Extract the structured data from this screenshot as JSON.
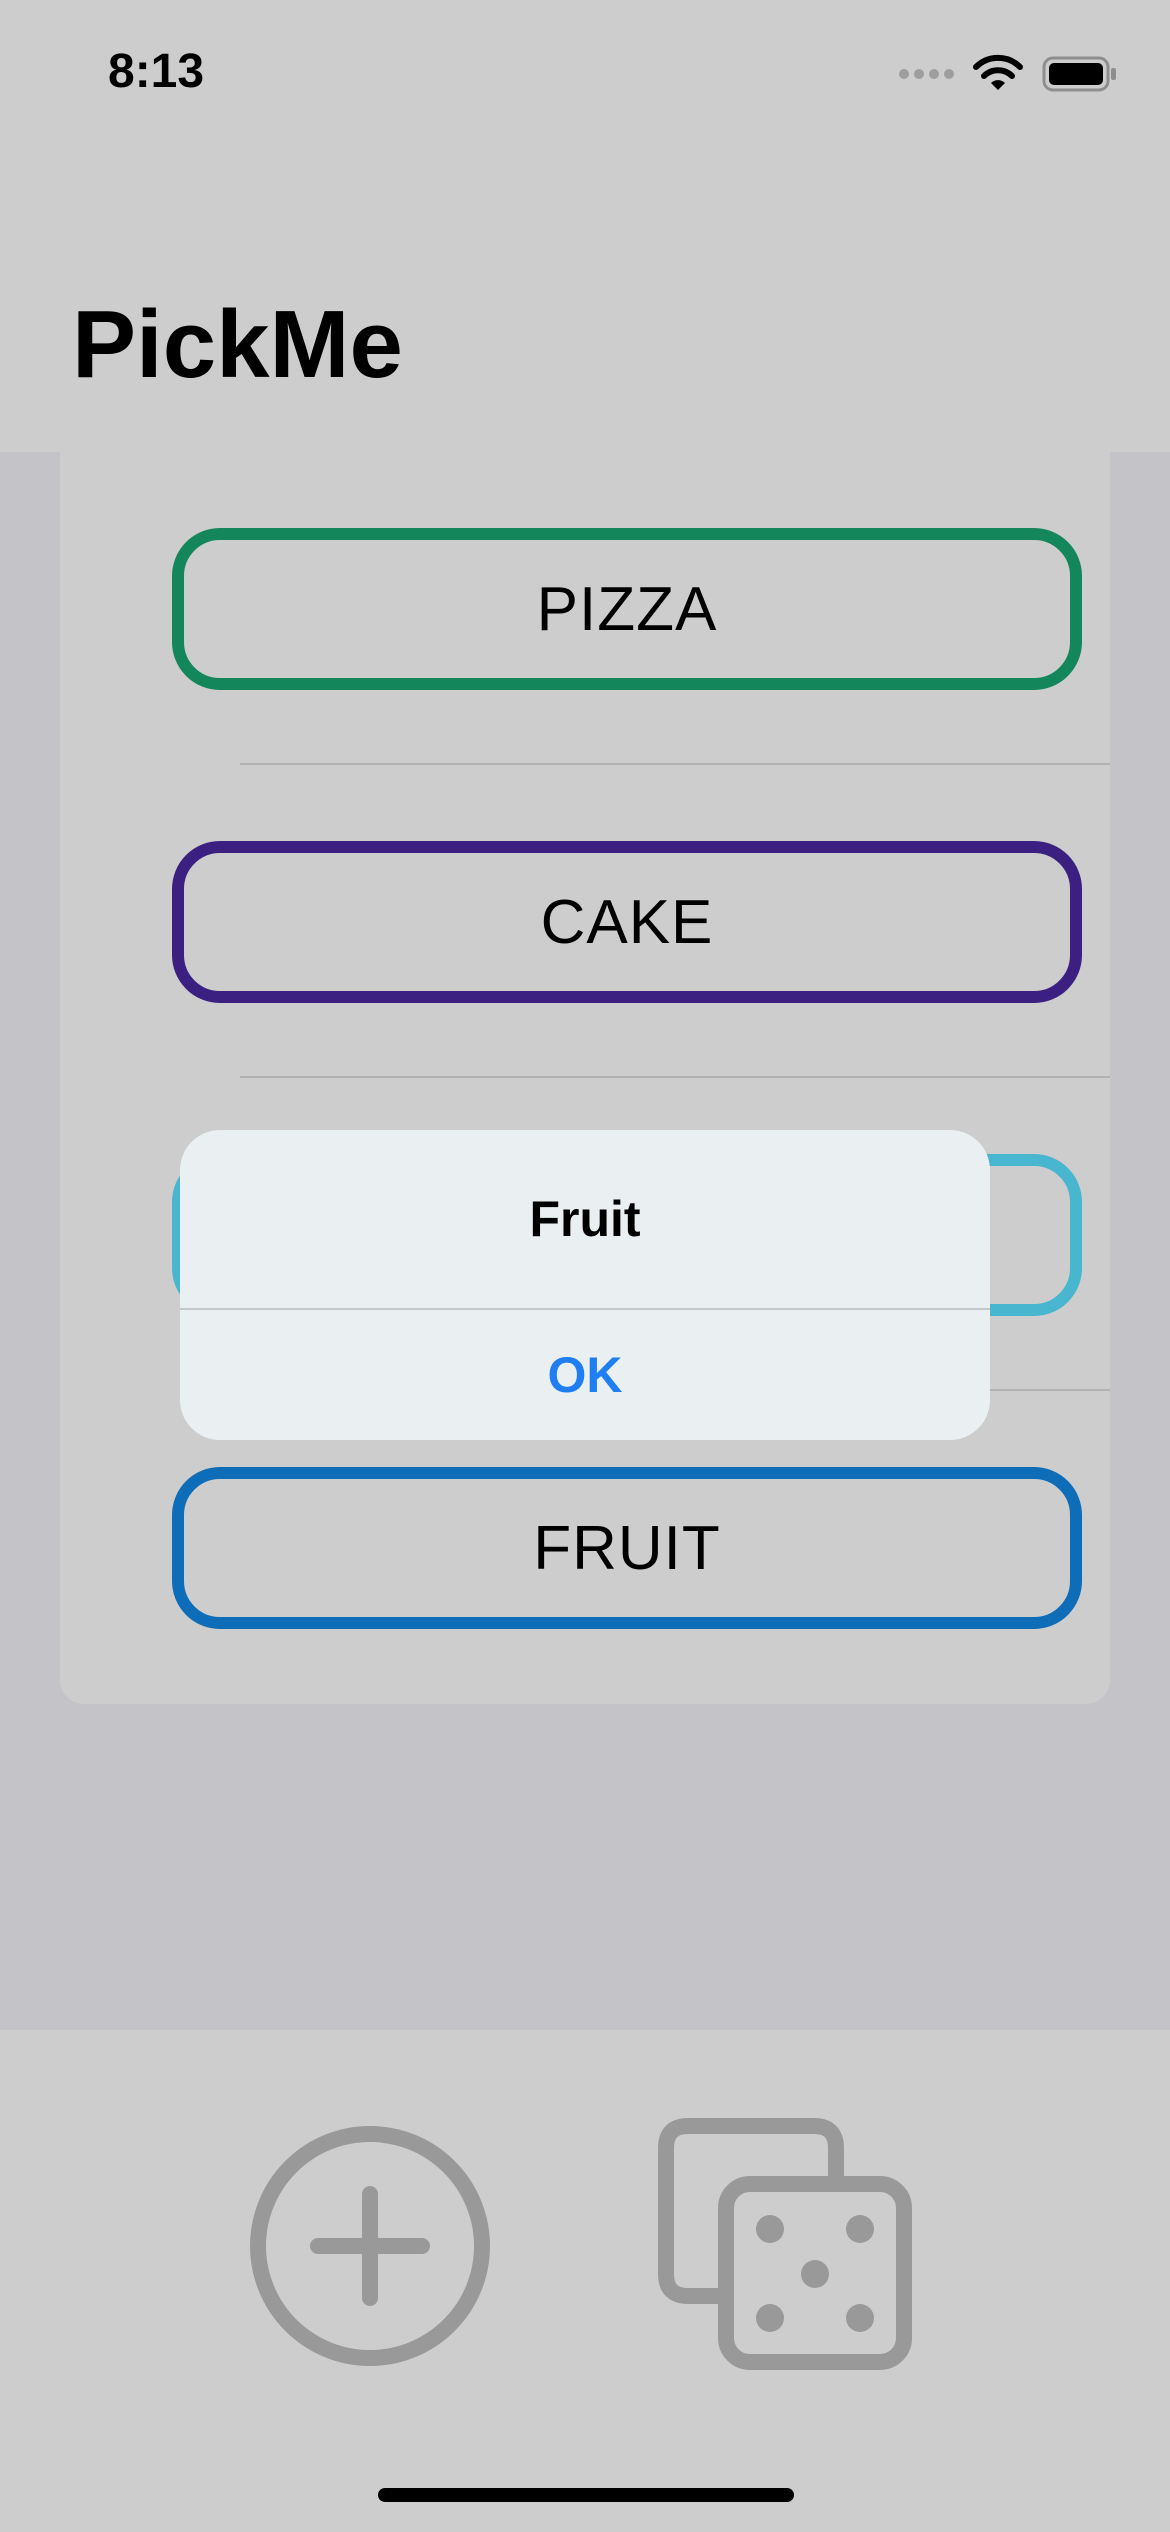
{
  "status_bar": {
    "time": "8:13",
    "icons": [
      "signal-icon",
      "wifi-icon",
      "battery-icon"
    ]
  },
  "nav": {
    "title": "PickMe"
  },
  "options": [
    {
      "label": "PIZZA",
      "color": "#14865b"
    },
    {
      "label": "CAKE",
      "color": "#3c2081"
    },
    {
      "label": "",
      "color": "#47b6ce"
    },
    {
      "label": "FRUIT",
      "color": "#0e6db9"
    }
  ],
  "alert": {
    "title": "Fruit",
    "ok_label": "OK",
    "ok_color": "#1f7ef2"
  },
  "toolbar": {
    "add_icon": "plus-circle-icon",
    "roll_icon": "dice-icon",
    "icon_color": "#999999"
  }
}
